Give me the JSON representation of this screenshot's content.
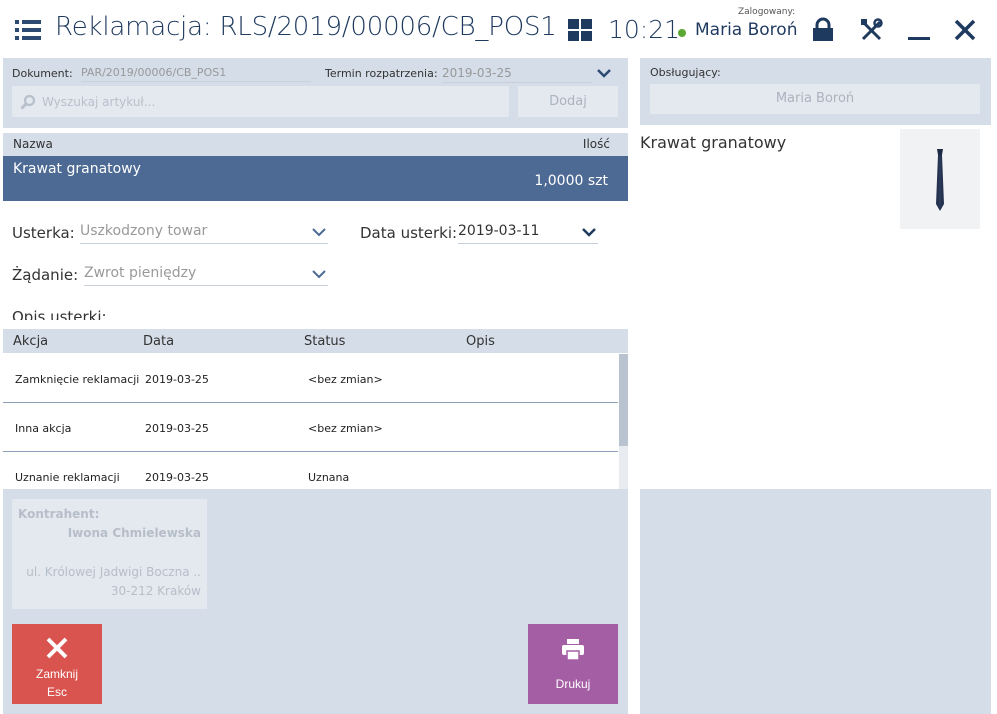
{
  "header": {
    "title": "Reklamacja: RLS/2019/00006/CB_POS1",
    "time": "10:21",
    "login_label": "Zalogowany:",
    "user": "Maria Boroń",
    "status_color": "#5aa832"
  },
  "document": {
    "label": "Dokument:",
    "value": "PAR/2019/00006/CB_POS1",
    "deadline_label": "Termin rozpatrzenia:",
    "deadline_value": "2019-03-25"
  },
  "search": {
    "placeholder": "Wyszukaj artykuł...",
    "add_label": "Dodaj"
  },
  "items": {
    "headers": {
      "name": "Nazwa",
      "qty": "Ilość"
    },
    "rows": [
      {
        "name": "Krawat granatowy",
        "qty": "1,0000 szt"
      }
    ]
  },
  "form": {
    "defect_label": "Usterka:",
    "defect_value": "Uszkodzony towar",
    "defect_date_label": "Data usterki:",
    "defect_date_value": "2019-03-11",
    "demand_label": "Żądanie:",
    "demand_value": "Zwrot pieniędzy",
    "description_label": "Opis usterki:"
  },
  "actions": {
    "headers": {
      "action": "Akcja",
      "date": "Data",
      "status": "Status",
      "description": "Opis"
    },
    "rows": [
      {
        "action": "Zamknięcie reklamacji",
        "date": "2019-03-25",
        "status": "<bez zmian>",
        "description": ""
      },
      {
        "action": "Inna akcja",
        "date": "2019-03-25",
        "status": "<bez zmian>",
        "description": ""
      },
      {
        "action": "Uznanie reklamacji",
        "date": "2019-03-25",
        "status": "Uznana",
        "description": ""
      }
    ]
  },
  "contractor": {
    "label": "Kontrahent:",
    "name": "Iwona Chmielewska",
    "address1": "ul. Królowej Jadwigi Boczna ..",
    "address2": "30-212 Kraków"
  },
  "buttons": {
    "close_label": "Zamknij",
    "close_shortcut": "Esc",
    "print_label": "Drukuj"
  },
  "handler": {
    "label": "Obsługujący:",
    "value": "Maria Boroń"
  },
  "product": {
    "name": "Krawat granatowy"
  },
  "colors": {
    "accent": "#1f3a5f",
    "selected_row": "#4d6a94",
    "panel": "#d4dde8",
    "close": "#d9534f",
    "print": "#a45fa4"
  }
}
